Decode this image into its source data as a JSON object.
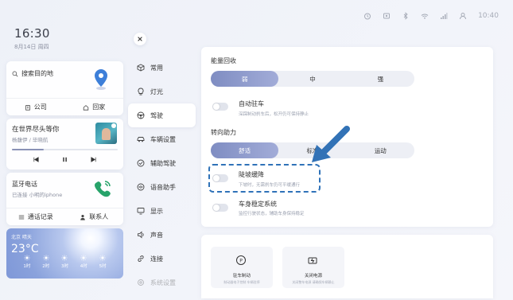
{
  "status": {
    "time": "10:40"
  },
  "clock": {
    "time": "16:30",
    "date": "8月14日 周四"
  },
  "nav": {
    "search": "搜索目的地",
    "company": "公司",
    "home": "回家"
  },
  "music": {
    "title": "在世界尽头等你",
    "artist": "杨馥伊 / 毕晓航",
    "progress": 0.3
  },
  "phone": {
    "title": "蓝牙电话",
    "subtitle": "已连接 小明的iphone",
    "calls": "通话记录",
    "contacts": "联系人"
  },
  "weather": {
    "location": "北京 晴天",
    "temp": "23°C",
    "days": [
      "1时",
      "2时",
      "3时",
      "4时",
      "5时"
    ]
  },
  "menu": [
    {
      "label": "常用",
      "icon": "cube-icon"
    },
    {
      "label": "灯光",
      "icon": "bulb-icon"
    },
    {
      "label": "驾驶",
      "icon": "steering-wheel-icon",
      "active": true
    },
    {
      "label": "车辆设置",
      "icon": "car-icon"
    },
    {
      "label": "辅助驾驶",
      "icon": "assist-icon"
    },
    {
      "label": "语音助手",
      "icon": "voice-icon"
    },
    {
      "label": "显示",
      "icon": "display-icon"
    },
    {
      "label": "声音",
      "icon": "speaker-icon"
    },
    {
      "label": "连接",
      "icon": "link-icon"
    },
    {
      "label": "系统设置",
      "icon": "settings-icon",
      "faded": true
    }
  ],
  "energy": {
    "label": "能量回收",
    "options": [
      "弱",
      "中",
      "强"
    ],
    "selected": 0
  },
  "auto_hold": {
    "title": "自动驻车",
    "desc": "深踩制动刹车后，松开仍可保持静止"
  },
  "steering": {
    "label": "转向助力",
    "options": [
      "舒适",
      "标准",
      "运动"
    ],
    "selected": 0
  },
  "hill_descent": {
    "title": "陡坡缓降",
    "desc": "下坡时，无需刹车仍可平缓通行"
  },
  "stability": {
    "title": "车身稳定系统",
    "desc": "监控行驶状态，辅助车身保持稳定"
  },
  "tiles": [
    {
      "title": "驻车制动",
      "desc": "制动器电子控制 车辆驻停",
      "icon": "parking-brake-icon"
    },
    {
      "title": "关闭电源",
      "desc": "关闭整车电源 请确保车辆静止",
      "icon": "power-off-icon"
    }
  ],
  "colors": {
    "accent": "#7f8dc2",
    "highlight": "#2f72b8"
  }
}
